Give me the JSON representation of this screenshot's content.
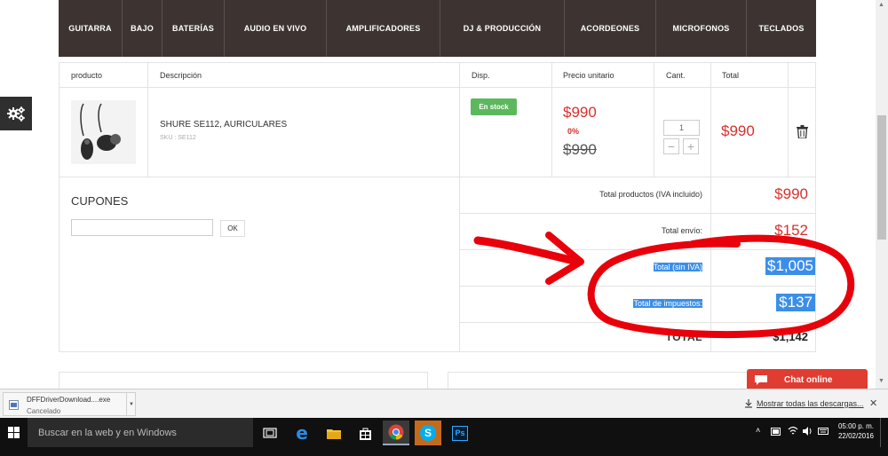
{
  "nav": {
    "items": [
      "GUITARRA",
      "BAJO",
      "BATERÍAS",
      "AUDIO EN VIVO",
      "AMPLIFICADORES",
      "DJ & PRODUCCIÓN",
      "ACORDEONES",
      "MICROFONOS",
      "TECLADOS"
    ]
  },
  "cart": {
    "headers": {
      "product": "producto",
      "description": "Descripción",
      "availability": "Disp.",
      "unit_price": "Precio unitario",
      "quantity": "Cant.",
      "total": "Total"
    },
    "item": {
      "name": "SHURE SE112, AURICULARES",
      "sku": "SKU : SE112",
      "stock": "En stock",
      "price": "$990",
      "discount": "0%",
      "old_price": "$990",
      "quantity": "1",
      "total": "$990",
      "minus": "−",
      "plus": "+"
    },
    "coupons": {
      "title": "CUPONES",
      "input_value": "",
      "ok_label": "OK"
    },
    "summary": {
      "products_label": "Total productos (IVA incluido)",
      "products_value": "$990",
      "shipping_label": "Total envío:",
      "shipping_value": "$152",
      "net_label": "Total (sin IVA)",
      "net_value": "$1,005",
      "tax_label": "Total de impuestos:",
      "tax_value": "$137",
      "total_label": "TOTAL",
      "total_value": "$1,142"
    }
  },
  "chat": {
    "label": "Chat online"
  },
  "downloads": {
    "file_name": "DFFDriverDownload....exe",
    "status": "Cancelado",
    "show_all": "Mostrar todas las descargas..."
  },
  "taskbar": {
    "search_placeholder": "Buscar en la web y en Windows",
    "time": "05:00 p. m.",
    "date": "22/02/2016"
  },
  "colors": {
    "nav_bg": "#3d3431",
    "price_red": "#d9302c",
    "stock_green": "#5cb85c",
    "selection_blue": "#3b8ee8",
    "chat_red": "#e03c31"
  }
}
